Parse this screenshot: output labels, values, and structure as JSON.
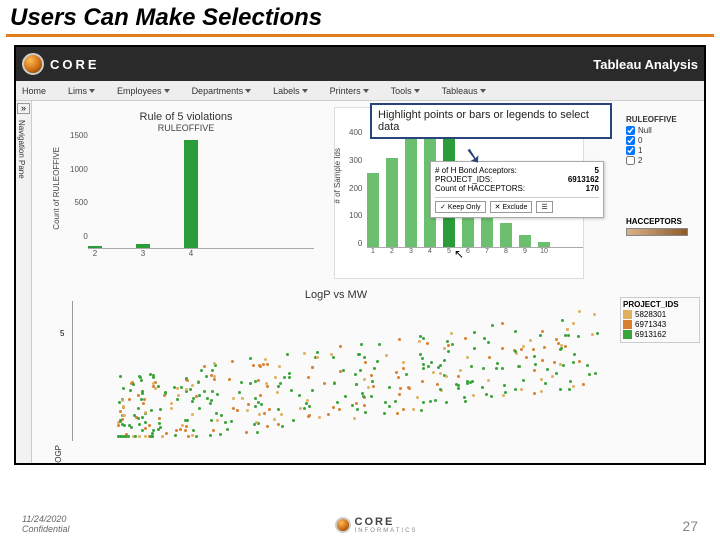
{
  "slide": {
    "title": "Users Can Make Selections",
    "date": "11/24/2020",
    "confidential": "Confidential",
    "page": "27"
  },
  "brand": {
    "name": "CORE",
    "sub": "INFORMATICS"
  },
  "analysis_title": "Tableau Analysis",
  "menu": [
    "Home",
    "Lims ▾",
    "Employees ▾",
    "Departments ▾",
    "Labels ▾",
    "Printers ▾",
    "Tools ▾",
    "Tableaus ▾"
  ],
  "navpane": {
    "toggle": "»",
    "label": "Navigation Pane"
  },
  "callout": "Highlight points or bars or legends to select data",
  "chart_data": [
    {
      "type": "bar",
      "title": "Rule of 5 violations",
      "subtitle": "RULEOFFIVE",
      "ylabel": "Count of RULEOFFIVE",
      "categories": [
        "2",
        "3",
        "4"
      ],
      "values": [
        25,
        60,
        1480
      ],
      "yticks": [
        "1500",
        "1000",
        "500",
        "0"
      ],
      "ylim": [
        0,
        1500
      ]
    },
    {
      "type": "bar",
      "title": "# of H Bond Acceptors",
      "ylabel": "# of Sample Ids",
      "categories": [
        "1",
        "2",
        "3",
        "4",
        "5",
        "6",
        "7",
        "8",
        "9",
        "10"
      ],
      "values": [
        250,
        300,
        380,
        395,
        390,
        260,
        130,
        80,
        40,
        15
      ],
      "yticks": [
        "400",
        "300",
        "200",
        "100",
        "0"
      ],
      "ylim": [
        0,
        400
      ],
      "selected_index": 4
    },
    {
      "type": "scatter",
      "title": "LogP vs MW",
      "ylabel": "OGP",
      "ytick": "5"
    }
  ],
  "tooltip": {
    "rows": [
      {
        "k": "# of H Bond Acceptors:",
        "v": "5"
      },
      {
        "k": "PROJECT_IDS:",
        "v": "6913162"
      },
      {
        "k": "Count of HACCEPTORS:",
        "v": "170"
      }
    ],
    "keep": "Keep Only",
    "exclude": "Exclude"
  },
  "legend_right": {
    "title": "RULEOFFIVE",
    "items": [
      {
        "label": "Null",
        "checked": true
      },
      {
        "label": "0",
        "checked": true
      },
      {
        "label": "1",
        "checked": true
      },
      {
        "label": "2",
        "checked": false
      }
    ]
  },
  "hacc_legend": {
    "title": "HACCEPTORS"
  },
  "proj_legend": {
    "title": "PROJECT_IDS",
    "items": [
      {
        "label": "5828301",
        "color": "#e0b060"
      },
      {
        "label": "6971343",
        "color": "#d98030"
      },
      {
        "label": "6913162",
        "color": "#3aa43a"
      }
    ]
  }
}
